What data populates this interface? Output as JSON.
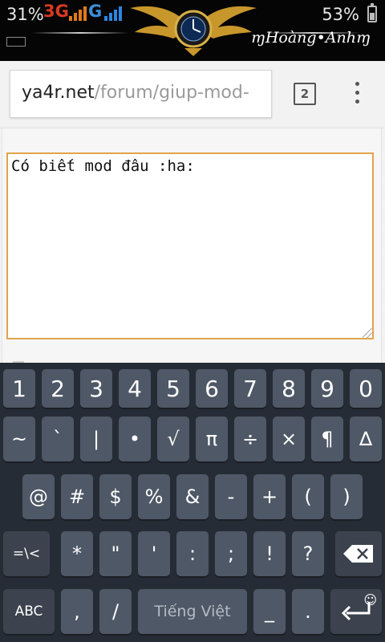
{
  "status_bar": {
    "battery_left": "31%",
    "network_1": "3G",
    "network_2": "G",
    "battery_right": "53%",
    "signature": "ɱHoàng•Anhɱ"
  },
  "browser": {
    "url_host": "ya4r.net",
    "url_path": "/forum/giup-mod-",
    "tab_count": "2"
  },
  "page": {
    "textarea_value": "Có biết mod đâu :ha:"
  },
  "keyboard": {
    "row1": [
      "1",
      "2",
      "3",
      "4",
      "5",
      "6",
      "7",
      "8",
      "9",
      "0"
    ],
    "row2": [
      "~",
      "`",
      "|",
      "•",
      "√",
      "π",
      "÷",
      "×",
      "¶",
      "∆"
    ],
    "row3": [
      "@",
      "#",
      "$",
      "%",
      "&",
      "-",
      "+",
      "(",
      ")"
    ],
    "row4": [
      "=\\<",
      "*",
      "\"",
      "'",
      ":",
      ";",
      "!",
      "?"
    ],
    "row5": {
      "abc": "ABC",
      "comma": ",",
      "slash": "/",
      "space": "Tiếng Việt",
      "underscore": "_",
      "period": "."
    },
    "accent_color": "#4f5866"
  }
}
